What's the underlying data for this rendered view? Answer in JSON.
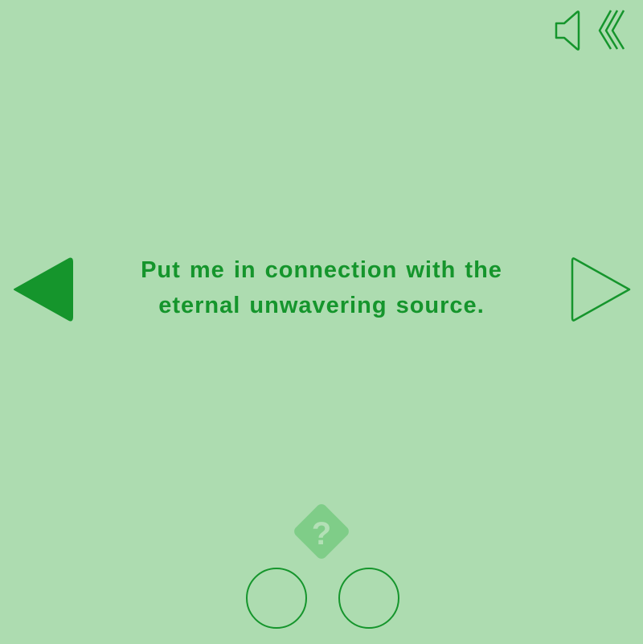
{
  "colors": {
    "background": "#addcb0",
    "accent": "#15952c",
    "help_fill": "#7fcd88",
    "help_text": "#b3e0b6"
  },
  "toolbar": {
    "speaker_icon": "speaker-icon",
    "back_icon": "triple-chevron-left-icon"
  },
  "navigation": {
    "prev_icon": "filled-triangle-left-icon",
    "next_icon": "outline-triangle-right-icon"
  },
  "message": {
    "text": "Put me in connection with the eternal unwavering source."
  },
  "help": {
    "label": "?",
    "icon": "diamond-help-icon"
  },
  "choices": {
    "icons": [
      "circle-icon",
      "circle-icon"
    ]
  }
}
